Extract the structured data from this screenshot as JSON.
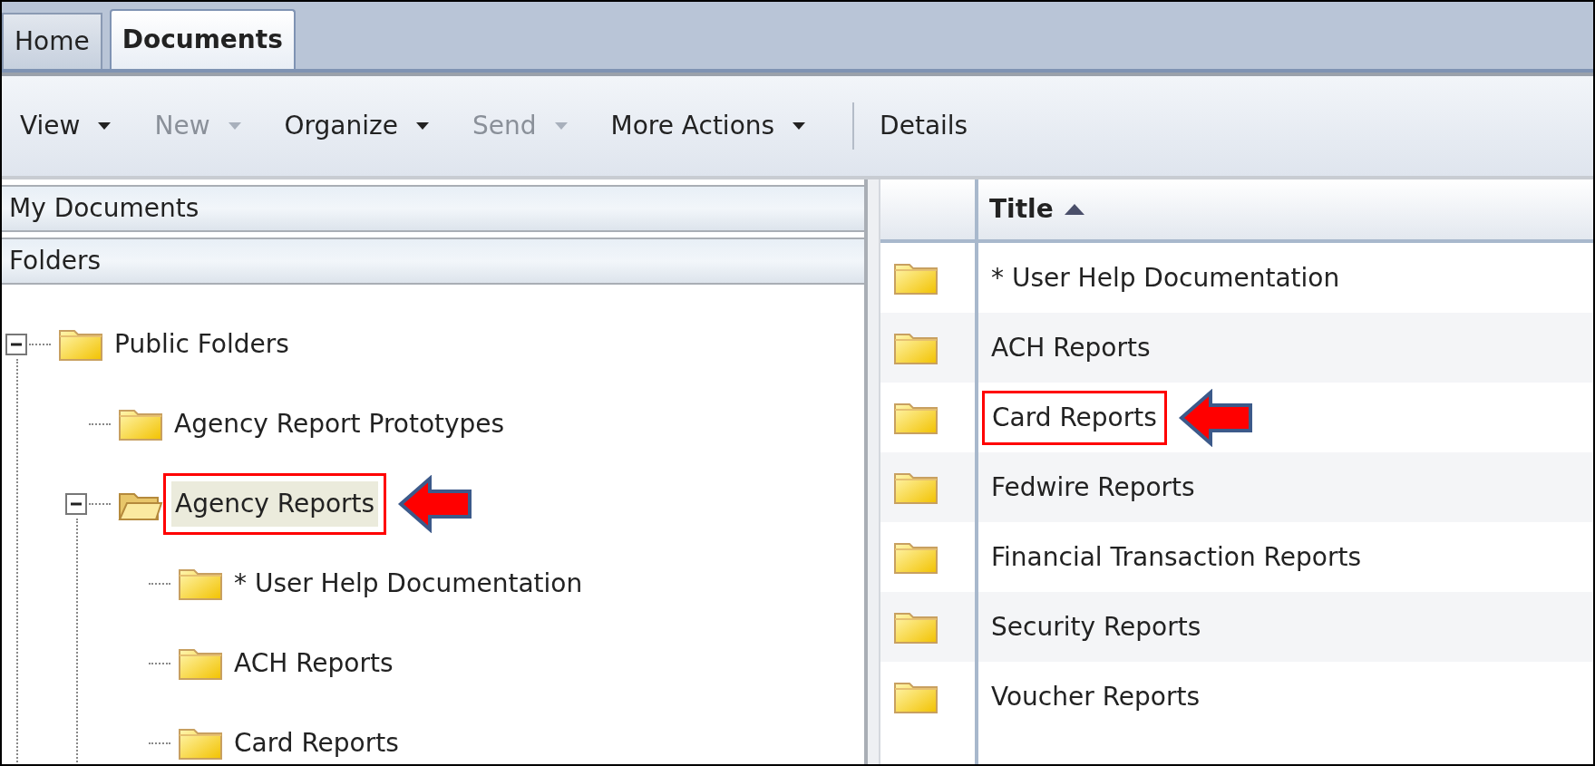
{
  "tabs": [
    {
      "label": "Home",
      "selected": false
    },
    {
      "label": "Documents",
      "selected": true
    }
  ],
  "toolbar": [
    {
      "kind": "menu",
      "label": "View",
      "disabled": false
    },
    {
      "kind": "menu",
      "label": "New",
      "disabled": true
    },
    {
      "kind": "menu",
      "label": "Organize",
      "disabled": false
    },
    {
      "kind": "menu",
      "label": "Send",
      "disabled": true
    },
    {
      "kind": "menu",
      "label": "More Actions",
      "disabled": false
    },
    {
      "kind": "separator"
    },
    {
      "kind": "button",
      "label": "Details",
      "disabled": false
    }
  ],
  "left_pane": {
    "sections": [
      "My Documents",
      "Folders"
    ],
    "tree": [
      {
        "label": "Public Folders",
        "expanded": true,
        "selected": false,
        "annotated": false,
        "children": [
          {
            "label": "Agency Report Prototypes",
            "selected": false,
            "annotated": false
          },
          {
            "label": "Agency Reports",
            "expanded": true,
            "selected": true,
            "annotated": true,
            "children": [
              {
                "label": "* User Help Documentation",
                "selected": false,
                "annotated": false
              },
              {
                "label": "ACH Reports",
                "selected": false,
                "annotated": false
              },
              {
                "label": "Card Reports",
                "selected": false,
                "annotated": false
              }
            ]
          }
        ]
      }
    ]
  },
  "list": {
    "columns": [
      "Title"
    ],
    "sorted_ascending": true,
    "rows": [
      {
        "title": "* User Help Documentation",
        "annotated": false
      },
      {
        "title": "ACH Reports",
        "annotated": false
      },
      {
        "title": "Card Reports",
        "annotated": true
      },
      {
        "title": "Fedwire Reports",
        "annotated": false
      },
      {
        "title": "Financial Transaction Reports",
        "annotated": false
      },
      {
        "title": "Security Reports",
        "annotated": false
      },
      {
        "title": "Voucher Reports",
        "annotated": false
      }
    ]
  }
}
